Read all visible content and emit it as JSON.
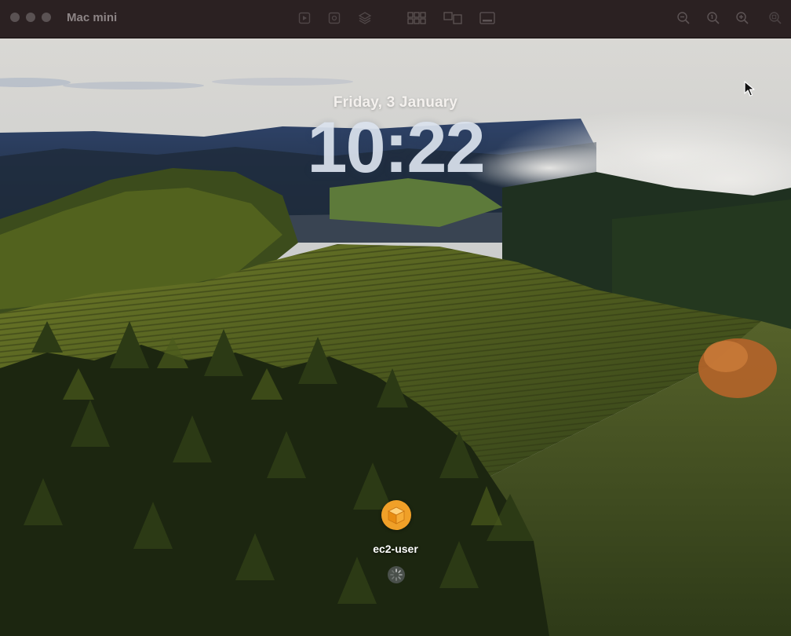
{
  "window": {
    "title": "Mac mini"
  },
  "toolbar": {
    "icons": [
      "play-icon",
      "screenshot-icon",
      "layers-icon",
      "grid-view-icon",
      "split-view-icon",
      "fullscreen-icon",
      "zoom-out-icon",
      "zoom-actual-icon",
      "zoom-in-icon",
      "zoom-fit-icon"
    ]
  },
  "lockscreen": {
    "date": "Friday, 3 January",
    "time": "10:22",
    "username": "ec2-user",
    "avatar_color": "#f0a028"
  },
  "colors": {
    "titlebar": "#2b2122",
    "title_text": "#8d8586"
  }
}
